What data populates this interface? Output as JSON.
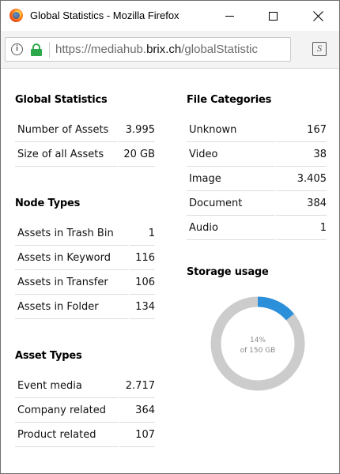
{
  "window": {
    "title": "Global Statistics - Mozilla Firefox",
    "browser": "Mozilla Firefox"
  },
  "address_bar": {
    "url_prefix": "https://mediahub.",
    "url_host": "brix.ch",
    "url_suffix": "/globalStatistic"
  },
  "global_statistics": {
    "title": "Global Statistics",
    "rows": [
      {
        "label": "Number of Assets",
        "value": "3.995"
      },
      {
        "label": "Size of all Assets",
        "value": "20 GB"
      }
    ]
  },
  "node_types": {
    "title": "Node Types",
    "rows": [
      {
        "label": "Assets in Trash Bin",
        "value": "1"
      },
      {
        "label": "Assets in Keyword",
        "value": "116"
      },
      {
        "label": "Assets in Transfer",
        "value": "106"
      },
      {
        "label": "Assets in Folder",
        "value": "134"
      }
    ]
  },
  "asset_types": {
    "title": "Asset Types",
    "rows": [
      {
        "label": "Event media",
        "value": "2.717"
      },
      {
        "label": "Company related",
        "value": "364"
      },
      {
        "label": "Product related",
        "value": "107"
      }
    ]
  },
  "file_categories": {
    "title": "File Categories",
    "rows": [
      {
        "label": "Unknown",
        "value": "167"
      },
      {
        "label": "Video",
        "value": "38"
      },
      {
        "label": "Image",
        "value": "3.405"
      },
      {
        "label": "Document",
        "value": "384"
      },
      {
        "label": "Audio",
        "value": "1"
      }
    ]
  },
  "storage_usage": {
    "title": "Storage usage",
    "percent_label": "14%",
    "capacity_label": "of 150 GB",
    "used_fraction": 0.14,
    "used_color": "#2b8fd9",
    "free_color": "#cccccc"
  },
  "icons": {
    "app": "firefox-logo-icon",
    "site_info": "info-icon",
    "secure": "lock-icon",
    "reader": "reader-view-icon"
  }
}
